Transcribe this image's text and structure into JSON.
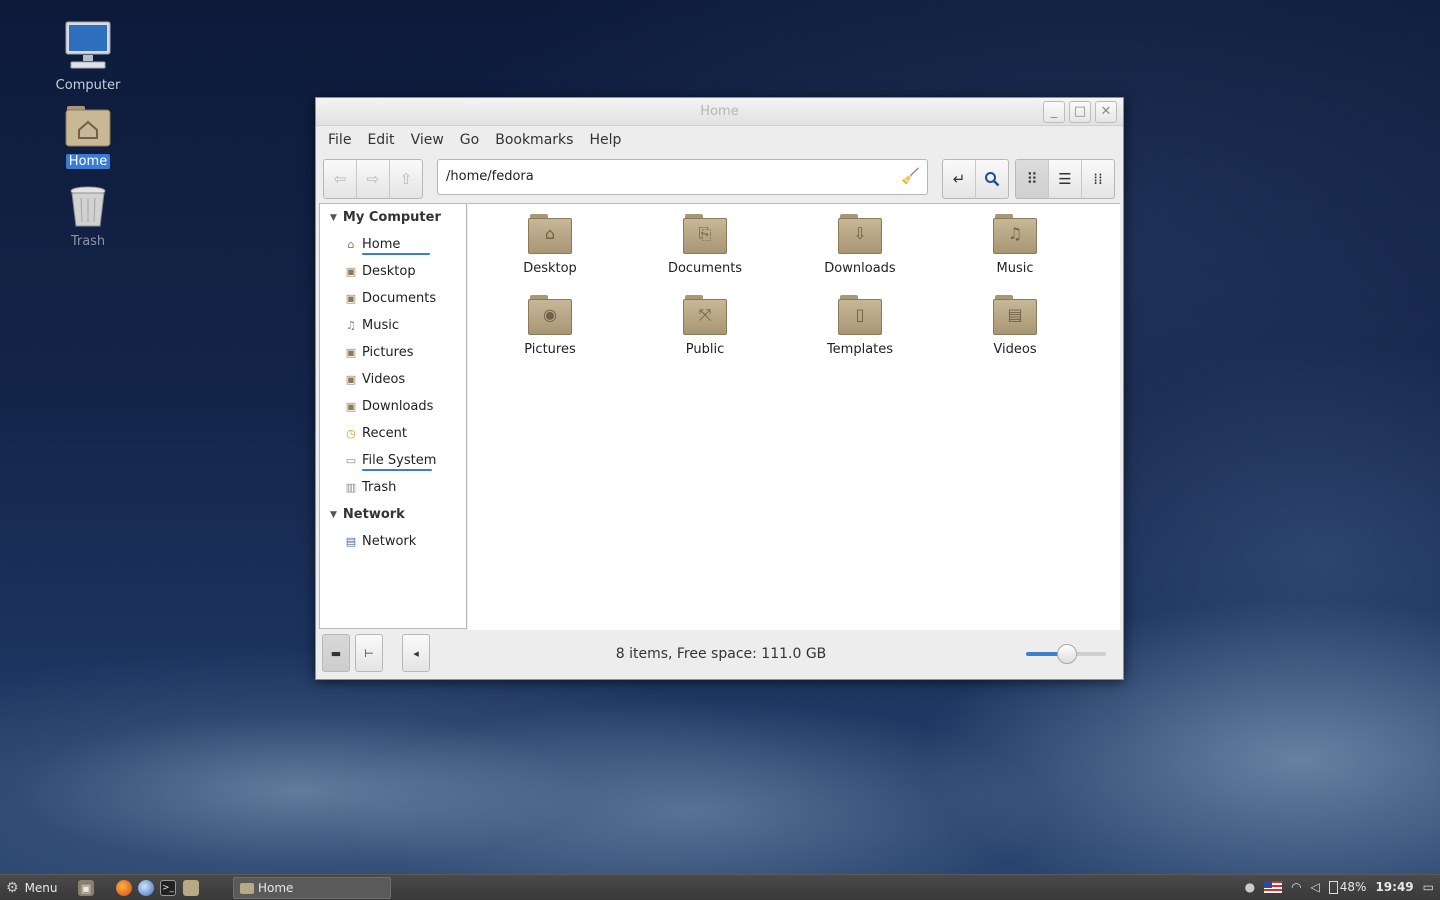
{
  "desktop": {
    "icons": [
      {
        "label": "Computer"
      },
      {
        "label": "Home"
      },
      {
        "label": "Trash"
      }
    ]
  },
  "window": {
    "title": "Home",
    "controls": {
      "minimize": "_",
      "maximize": "□",
      "close": "✕"
    },
    "menu": [
      "File",
      "Edit",
      "View",
      "Go",
      "Bookmarks",
      "Help"
    ],
    "toolbar": {
      "path": "/home/fedora",
      "nav_icons": {
        "back": "⇦",
        "forward": "⇨",
        "up": "⇧"
      },
      "view_icons": {
        "icon_view": "⠿",
        "list_view": "☰",
        "compact_view": "⁞⁞"
      }
    },
    "sidebar": {
      "sections": [
        {
          "title": "My Computer",
          "items": [
            "Home",
            "Desktop",
            "Documents",
            "Music",
            "Pictures",
            "Videos",
            "Downloads",
            "Recent",
            "File System",
            "Trash"
          ]
        },
        {
          "title": "Network",
          "items": [
            "Network"
          ]
        }
      ]
    },
    "files": [
      {
        "name": "Desktop",
        "icon": "desktop-folder-icon"
      },
      {
        "name": "Documents",
        "icon": "documents-folder-icon"
      },
      {
        "name": "Downloads",
        "icon": "downloads-folder-icon"
      },
      {
        "name": "Music",
        "icon": "music-folder-icon"
      },
      {
        "name": "Pictures",
        "icon": "pictures-folder-icon"
      },
      {
        "name": "Public",
        "icon": "public-folder-icon"
      },
      {
        "name": "Templates",
        "icon": "templates-folder-icon"
      },
      {
        "name": "Videos",
        "icon": "videos-folder-icon"
      }
    ],
    "status": "8 items, Free space: 111.0 GB",
    "zoom_fraction": 0.5
  },
  "taskbar": {
    "menu_label": "Menu",
    "task_label": "Home",
    "battery": "48%",
    "clock": "19:49"
  },
  "colors": {
    "accent": "#3d7ec7",
    "folder": "#b9a885"
  }
}
